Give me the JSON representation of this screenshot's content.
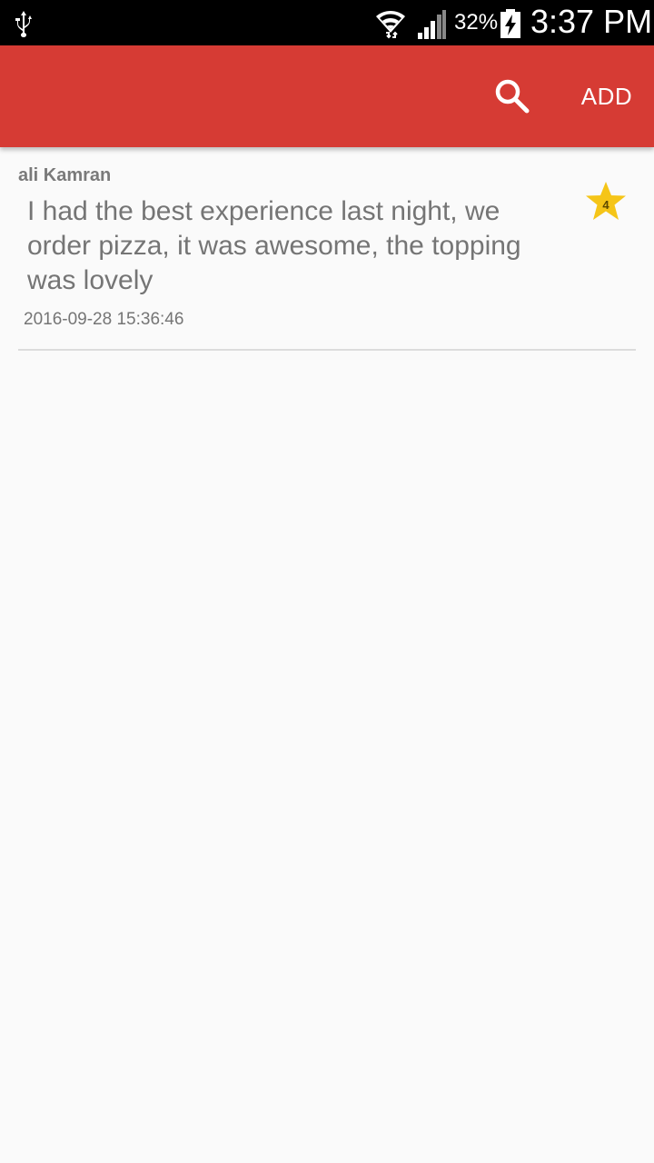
{
  "status_bar": {
    "battery_percent": "32%",
    "time": "3:37 PM",
    "icons": [
      "usb-icon",
      "wifi-icon",
      "signal-icon",
      "battery-charging-icon"
    ]
  },
  "app_bar": {
    "color": "#d63b34",
    "search_icon": "search-icon",
    "add_label": "ADD"
  },
  "reviews": [
    {
      "author": "ali Kamran",
      "text": "I had the best experience last night, we order pizza, it was awesome, the topping was lovely",
      "date": "2016-09-28 15:36:46",
      "rating": "4",
      "rating_icon": "star-icon",
      "rating_color": "#f5c518"
    }
  ]
}
